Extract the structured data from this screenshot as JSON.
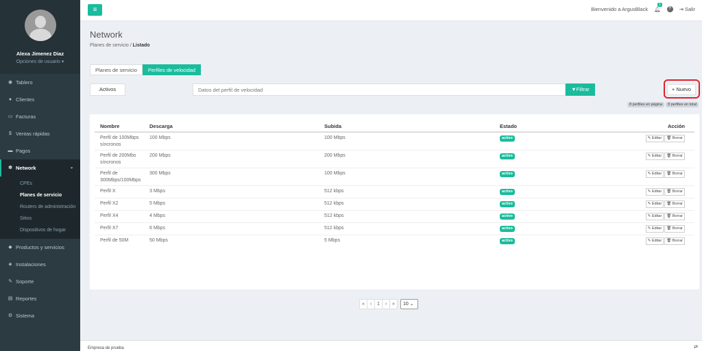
{
  "app": {
    "menu_icon": "menu-icon",
    "accent": "#1abc9c"
  },
  "sidebar": {
    "user_name": "Alexa Jimenez Diaz",
    "user_options": "Opciones de usuario ▾",
    "items": [
      {
        "label": "Tablero",
        "icon": "dashboard-icon"
      },
      {
        "label": "Clientes",
        "icon": "users-icon"
      },
      {
        "label": "Facturas",
        "icon": "file-icon"
      },
      {
        "label": "Ventas rápidas",
        "icon": "dollar-icon"
      },
      {
        "label": "Pagos",
        "icon": "money-icon"
      },
      {
        "label": "Network",
        "icon": "gear-icon"
      },
      {
        "label": "Productos y servicios",
        "icon": "cube-icon"
      },
      {
        "label": "Instalaciones",
        "icon": "tag-icon"
      },
      {
        "label": "Soporte",
        "icon": "wrench-icon"
      },
      {
        "label": "Reportes",
        "icon": "book-icon"
      },
      {
        "label": "Sistema",
        "icon": "cogs-icon"
      }
    ],
    "network_sub": [
      "CPEs",
      "Planes de servicio",
      "Routers de administración",
      "Sitios",
      "Dispositivos de hogar"
    ]
  },
  "topbar": {
    "welcome": "Bienvenido a ArgusBlack",
    "notifications": "1",
    "logout": "Salir"
  },
  "page": {
    "title": "Network",
    "breadcrumb_parent": "Planes de servicio",
    "breadcrumb_current": "Listado"
  },
  "tabs": [
    "Planes de servicio",
    "Perfiles de velocidad"
  ],
  "toolbar": {
    "active_filter": "Activos",
    "search_placeholder": "Datos del perfil de velocidad",
    "filter_label": "Filtrar",
    "new_label": "Nuevo",
    "page_count": "8 perfiles en página",
    "total_count": "8 perfiles en total"
  },
  "table": {
    "headers": [
      "Nombre",
      "Descarga",
      "Subida",
      "Estado",
      "Acción"
    ],
    "edit_label": "Editar",
    "delete_label": "Borrar",
    "rows": [
      {
        "name": "Perfil de 100Mbps síncronos",
        "down": "100 Mbps",
        "up": "100 Mbps",
        "status": "activo"
      },
      {
        "name": "Perfil de 200Mbs síncronos",
        "down": "200 Mbps",
        "up": "200 Mbps",
        "status": "activo"
      },
      {
        "name": "Perfil de 300Mbps/100Mbps",
        "down": "300 Mbps",
        "up": "100 Mbps",
        "status": "activo"
      },
      {
        "name": "Perfil X",
        "down": "3 Mbps",
        "up": "512 kbps",
        "status": "activo"
      },
      {
        "name": "Perfil X2",
        "down": "5 Mbps",
        "up": "512 kbps",
        "status": "activo"
      },
      {
        "name": "Perfil X4",
        "down": "4 Mbps",
        "up": "512 kbps",
        "status": "activo"
      },
      {
        "name": "Perfil X7",
        "down": "6 Mbps",
        "up": "512 kbps",
        "status": "activo"
      },
      {
        "name": "Perfil de 50M",
        "down": "50 Mbps",
        "up": "5 Mbps",
        "status": "activo"
      }
    ]
  },
  "pager": {
    "first": "«",
    "prev": "‹",
    "page": "1",
    "next": "›",
    "last": "»",
    "per_page": "10"
  },
  "footer": {
    "company": "Empresa de prueba"
  }
}
